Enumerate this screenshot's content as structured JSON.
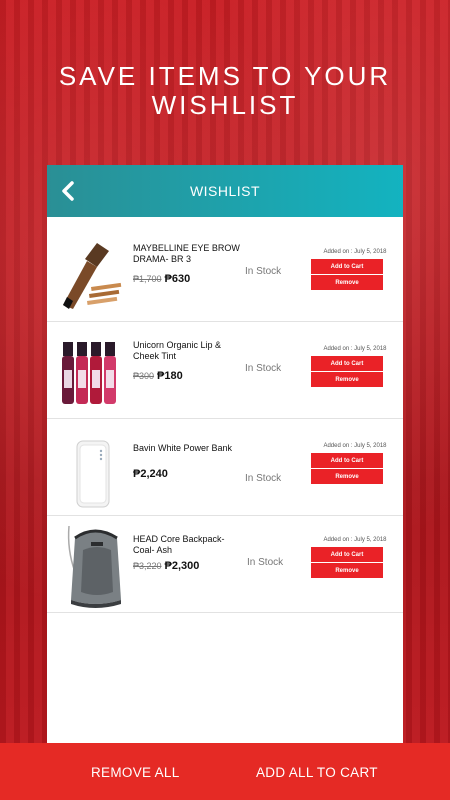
{
  "headline": {
    "line1": "SAVE ITEMS TO YOUR",
    "line2": "WISHLIST"
  },
  "topbar": {
    "title": "WISHLIST",
    "back_icon": "chevron-left-icon"
  },
  "items": [
    {
      "name": "MAYBELLINE EYE BROW DRAMA- BR 3",
      "old_price": "₱1,700",
      "price": "₱630",
      "stock": "In Stock",
      "added": "Added on : July 5, 2018",
      "add_label": "Add to Cart",
      "remove_label": "Remove"
    },
    {
      "name": "Unicorn Organic Lip & Cheek Tint",
      "old_price": "₱300",
      "price": "₱180",
      "stock": "In Stock",
      "added": "Added on : July 5, 2018",
      "add_label": "Add to Cart",
      "remove_label": "Remove"
    },
    {
      "name": "Bavin White Power Bank",
      "old_price": "",
      "price": "₱2,240",
      "stock": "In Stock",
      "added": "Added on : July 5, 2018",
      "add_label": "Add to Cart",
      "remove_label": "Remove"
    },
    {
      "name": "HEAD Core Backpack- Coal- Ash",
      "old_price": "₱3,220",
      "price": "₱2,300",
      "stock": "In Stock",
      "added": "Added on : July 5, 2018",
      "add_label": "Add to Cart",
      "remove_label": "Remove"
    }
  ],
  "bottom": {
    "remove_all": "REMOVE ALL",
    "add_all": "ADD ALL TO CART"
  },
  "colors": {
    "accent_red": "#ea2227",
    "teal_start": "#2a8f95",
    "teal_end": "#13b3c0",
    "bg_red": "#b8141b"
  }
}
